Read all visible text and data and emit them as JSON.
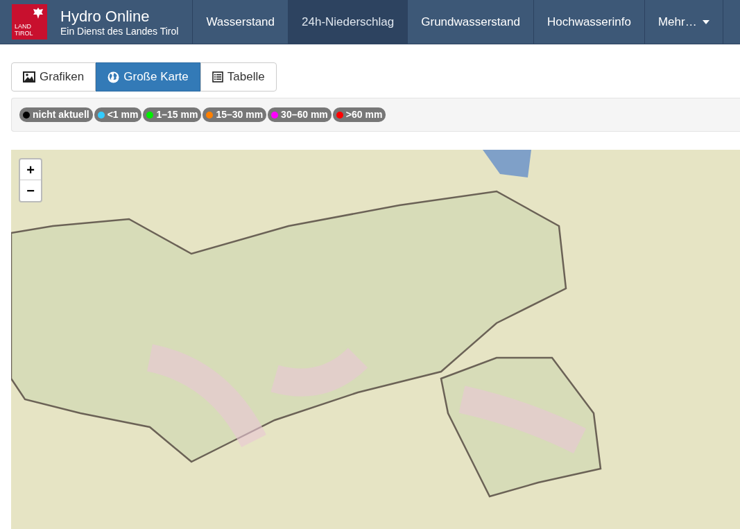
{
  "header": {
    "logo_lines": [
      "LAND",
      "TIROL"
    ],
    "title": "Hydro Online",
    "subtitle": "Ein Dienst des Landes Tirol",
    "nav": [
      {
        "label": "Wasserstand",
        "selected": false,
        "kind": "link"
      },
      {
        "label": "24h-Niederschlag",
        "selected": true,
        "kind": "link"
      },
      {
        "label": "Grundwasserstand",
        "selected": false,
        "kind": "link"
      },
      {
        "label": "Hochwasserinfo",
        "selected": false,
        "kind": "link"
      },
      {
        "label": "Mehr…",
        "selected": false,
        "kind": "dropdown"
      }
    ]
  },
  "view_tabs": [
    {
      "label": "Grafiken",
      "selected": false,
      "kind": "image"
    },
    {
      "label": "Große Karte",
      "selected": true,
      "kind": "globe"
    },
    {
      "label": "Tabelle",
      "selected": false,
      "kind": "table"
    }
  ],
  "legend": [
    {
      "label": "nicht aktuell",
      "color": "#000000"
    },
    {
      "label": "<1 mm",
      "color": "#33ccff"
    },
    {
      "label": "1–15 mm",
      "color": "#00ee00"
    },
    {
      "label": "15–30 mm",
      "color": "#ff8000"
    },
    {
      "label": "30–60 mm",
      "color": "#ff00ff"
    },
    {
      "label": ">60 mm",
      "color": "#ff0000"
    }
  ],
  "map": {
    "zoom_in": "+",
    "zoom_out": "−"
  }
}
